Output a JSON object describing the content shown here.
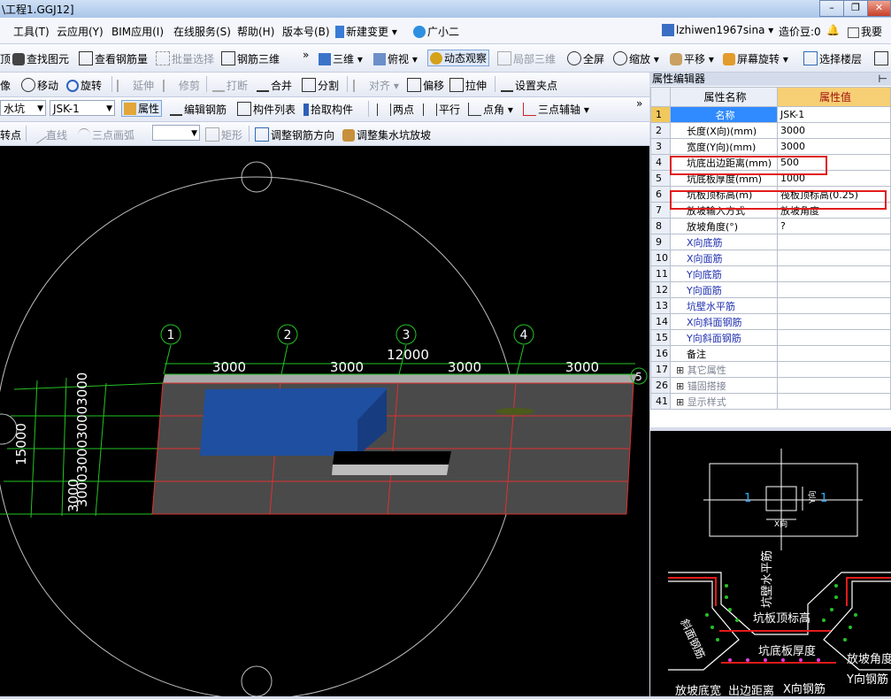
{
  "window": {
    "title": "\\工程1.GGJ12]"
  },
  "menu": {
    "items": [
      "工具(T)",
      "云应用(Y)",
      "BIM应用(I)",
      "在线服务(S)",
      "帮助(H)",
      "版本号(B)",
      "新建变更",
      "广小二"
    ],
    "user": "lzhiwen1967sina",
    "beans": "造价豆:0",
    "want": "我要"
  },
  "toolbar1": {
    "find": "查找图元",
    "rebar_qty": "查看钢筋量",
    "batch_select": "批量选择",
    "rebar_3d": "钢筋三维",
    "view3d": "三维",
    "top_view": "俯视",
    "dynamic_view": "动态观察",
    "local3d": "局部三维",
    "fullscreen": "全屏",
    "zoom": "缩放",
    "pan": "平移",
    "rotate_screen": "屏幕旋转",
    "select_floor": "选择楼层"
  },
  "toolbar2": {
    "lead": "像",
    "move": "移动",
    "rotate": "旋转",
    "extend": "延伸",
    "trim": "修剪",
    "break": "打断",
    "merge": "合并",
    "split": "分割",
    "align": "对齐",
    "offset": "偏移",
    "stretch": "拉伸",
    "set_grip": "设置夹点"
  },
  "toolbar3": {
    "type_combo": "水坑",
    "name_combo": "JSK-1",
    "property": "属性",
    "edit_rebar": "编辑钢筋",
    "component_list": "构件列表",
    "pick": "拾取构件",
    "two_point": "两点",
    "parallel": "平行",
    "point_angle": "点角",
    "three_point_aux": "三点辅轴"
  },
  "toolbar4": {
    "lead": "转点",
    "line": "直线",
    "arc": "三点画弧",
    "rect": "矩形",
    "adjust_rebar": "调整钢筋方向",
    "adjust_pit": "调整集水坑放坡"
  },
  "props": {
    "title": "属性编辑器",
    "col_name": "属性名称",
    "col_value": "属性值",
    "rows": [
      {
        "num": "1",
        "name": "名称",
        "value": "JSK-1"
      },
      {
        "num": "2",
        "name": "长度(X向)(mm)",
        "value": "3000"
      },
      {
        "num": "3",
        "name": "宽度(Y向)(mm)",
        "value": "3000"
      },
      {
        "num": "4",
        "name": "坑底出边距离(mm)",
        "value": "500"
      },
      {
        "num": "5",
        "name": "坑底板厚度(mm)",
        "value": "1000"
      },
      {
        "num": "6",
        "name": "坑板顶标高(m)",
        "value": "筏板顶标高(0.25)"
      },
      {
        "num": "7",
        "name": "放坡输入方式",
        "value": "放坡角度"
      },
      {
        "num": "8",
        "name": "放坡角度(°)",
        "value": "?"
      },
      {
        "num": "9",
        "name": "X向底筋",
        "value": ""
      },
      {
        "num": "10",
        "name": "X向面筋",
        "value": ""
      },
      {
        "num": "11",
        "name": "Y向底筋",
        "value": ""
      },
      {
        "num": "12",
        "name": "Y向面筋",
        "value": ""
      },
      {
        "num": "13",
        "name": "坑壁水平筋",
        "value": ""
      },
      {
        "num": "14",
        "name": "X向斜面钢筋",
        "value": ""
      },
      {
        "num": "15",
        "name": "Y向斜面钢筋",
        "value": ""
      },
      {
        "num": "16",
        "name": "备注",
        "value": ""
      },
      {
        "num": "17",
        "name": "其它属性",
        "value": ""
      },
      {
        "num": "26",
        "name": "锚固搭接",
        "value": ""
      },
      {
        "num": "41",
        "name": "显示样式",
        "value": ""
      }
    ]
  },
  "canvas": {
    "axes": [
      "1",
      "2",
      "3",
      "4",
      "5"
    ],
    "dims": [
      "3000",
      "3000",
      "3000",
      "3000"
    ],
    "total": "12000",
    "left_total": "15000",
    "left_dims": "3000300030003000",
    "left_bottom": "3000"
  },
  "preview": {
    "label_1": "1",
    "x_dir": "X向",
    "y_dir": "Y向",
    "wall_bar": "坑壁水平筋",
    "top_elev": "坑板顶标高",
    "bottom_thk": "坑底板厚度",
    "slope_bar": "斜面钢筋",
    "slope_angle": "放坡角度",
    "y_bar": "Y向钢筋",
    "x_bar": "X向钢筋",
    "slope_width": "放坡底宽",
    "edge_dist": "出边距离"
  },
  "colors": {
    "accent": "#2f8bff",
    "highlight": "#e21b1b",
    "grid": "#e03030",
    "slab": "#4a4a4a",
    "pit": "#1f4fa0"
  }
}
